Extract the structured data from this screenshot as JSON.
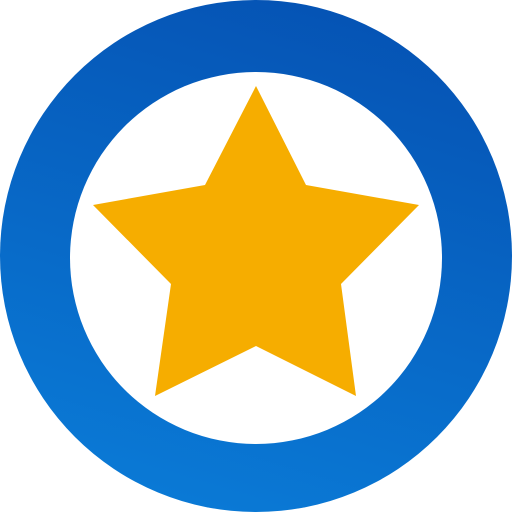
{
  "icon": {
    "name": "star-in-ring-icon",
    "ring_color_light": "#0A7AD6",
    "ring_color_dark": "#0553B4",
    "inner_color": "#FFFFFF",
    "star_color": "#F6AD00"
  }
}
